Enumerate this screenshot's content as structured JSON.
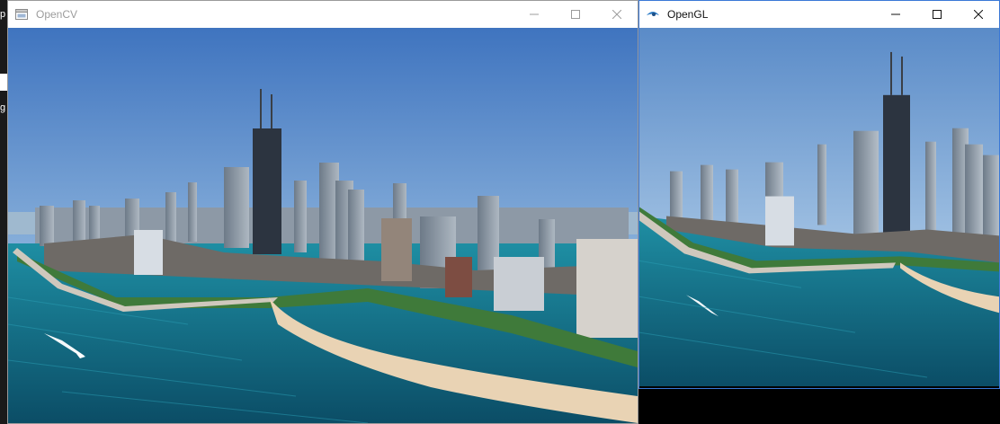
{
  "desktop": {
    "edge_fragments": [
      "p",
      "g"
    ]
  },
  "windows": [
    {
      "title": "OpenCV",
      "icon": "opencv-window-icon",
      "active": false,
      "controls": [
        "minimize",
        "maximize",
        "close"
      ]
    },
    {
      "title": "OpenGL",
      "icon": "opengl-eye-icon",
      "active": true,
      "controls": [
        "minimize",
        "maximize",
        "close"
      ]
    }
  ],
  "colors": {
    "sky_top": "#4a7ec4",
    "sky_bottom": "#b8d2ea",
    "water_deep": "#0e5a74",
    "water_light": "#1c8aa0",
    "sand": "#e9d3b4",
    "park": "#3f7a3a",
    "active_border": "#3a78d6"
  }
}
